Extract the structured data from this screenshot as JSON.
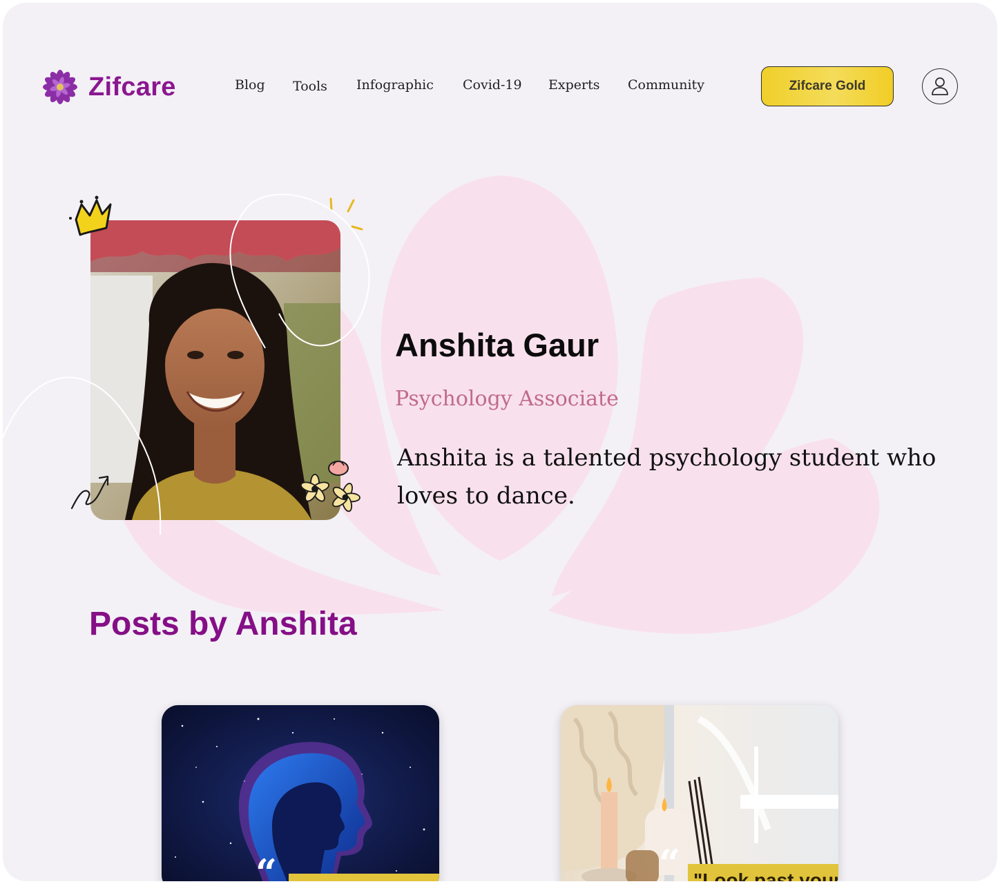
{
  "brand": {
    "name": "Zifcare",
    "logo_icon": "flower-logo-icon"
  },
  "nav": {
    "links": [
      "Blog",
      "Tools",
      "Infographic",
      "Covid-19",
      "Experts",
      "Community"
    ],
    "gold_button": "Zifcare Gold",
    "profile_icon": "user-icon"
  },
  "profile": {
    "name": "Anshita Gaur",
    "role": "Psychology Associate",
    "bio": "Anshita is a talented psychology student who loves to dance."
  },
  "posts": {
    "title": "Posts by Anshita",
    "cards": [
      {
        "image": "cosmic-head-silhouette",
        "quote_text": ""
      },
      {
        "image": "candles-and-incense",
        "quote_text": "\"Look past your"
      }
    ]
  },
  "colors": {
    "brand_purple": "#8a1790",
    "heading_purple": "#850f86",
    "role_pink": "#c06a8c",
    "gold": "#f0cf2a",
    "background": "#f3f1f6",
    "lotus_pink": "#f8e1ec"
  }
}
